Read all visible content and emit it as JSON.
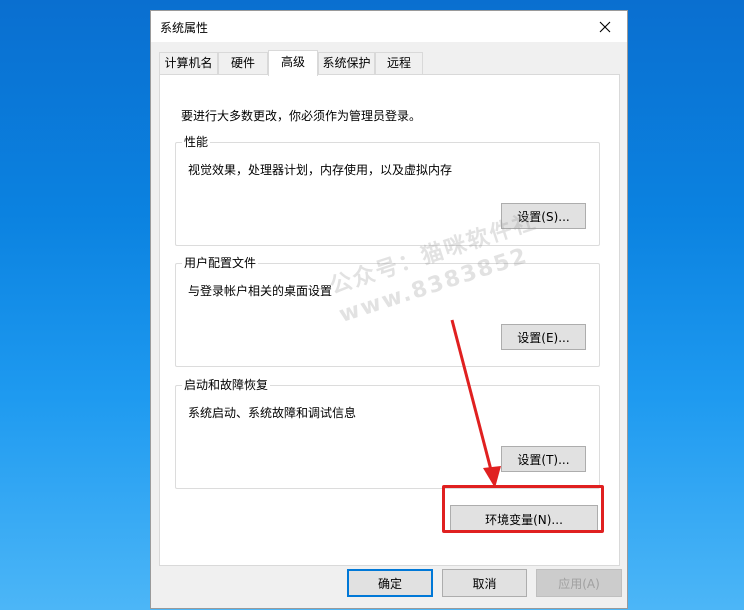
{
  "dialog": {
    "title": "系统属性",
    "tabs": [
      {
        "label": "计算机名"
      },
      {
        "label": "硬件"
      },
      {
        "label": "高级"
      },
      {
        "label": "系统保护"
      },
      {
        "label": "远程"
      }
    ],
    "active_tab": "高级",
    "notice": "要进行大多数更改，你必须作为管理员登录。",
    "groups": [
      {
        "title": "性能",
        "desc": "视觉效果，处理器计划，内存使用，以及虚拟内存",
        "button": "设置(S)..."
      },
      {
        "title": "用户配置文件",
        "desc": "与登录帐户相关的桌面设置",
        "button": "设置(E)..."
      },
      {
        "title": "启动和故障恢复",
        "desc": "系统启动、系统故障和调试信息",
        "button": "设置(T)..."
      }
    ],
    "env_button": "环境变量(N)...",
    "footer": {
      "ok": "确定",
      "cancel": "取消",
      "apply": "应用(A)"
    }
  },
  "watermark": {
    "line1": "公众号：猫咪软件社",
    "line2": "www.8383852"
  },
  "annotation_color": "#e02020",
  "accent_color": "#0078d7",
  "icons": {
    "close": "close-icon"
  }
}
